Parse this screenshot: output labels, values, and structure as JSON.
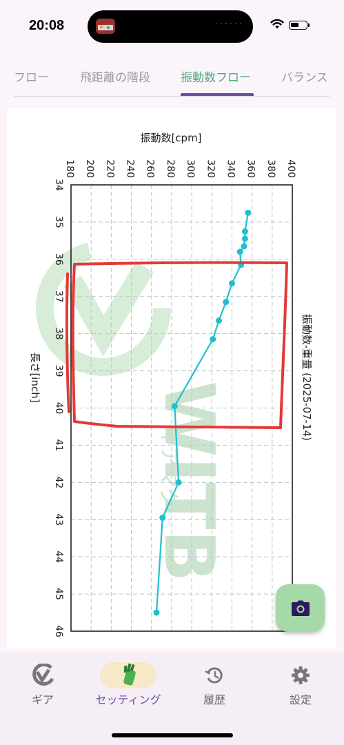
{
  "status_bar": {
    "time": "20:08",
    "island_dots": "······"
  },
  "tabs": [
    {
      "label": "フロー",
      "active": false
    },
    {
      "label": "飛距離の階段",
      "active": false
    },
    {
      "label": "振動数フロー",
      "active": true
    },
    {
      "label": "バランス",
      "active": false
    }
  ],
  "watermark": {
    "text": "WITB",
    "sub": "キアマグ"
  },
  "chart_data": {
    "type": "line",
    "orientation": "rotated-90-clockwise",
    "title": "振動数-重量 (2025-07-14)",
    "xlabel": "長さ[inch]",
    "ylabel": "振動数[cpm]",
    "xlim": [
      34,
      46
    ],
    "ylim": [
      180,
      400
    ],
    "x_ticks": [
      "34",
      "35",
      "36",
      "37",
      "38",
      "39",
      "40",
      "41",
      "42",
      "43",
      "44",
      "45",
      "46"
    ],
    "y_ticks": [
      "180",
      "200",
      "220",
      "240",
      "260",
      "280",
      "300",
      "320",
      "340",
      "360",
      "380",
      "400"
    ],
    "grid": true,
    "series": [
      {
        "x": [
          34.75,
          35.25,
          35.45,
          35.65,
          35.8,
          36.15,
          36.65,
          37.15,
          37.65,
          38.15,
          39.95,
          42.0,
          42.95,
          45.5
        ],
        "y": [
          356,
          353,
          353,
          352,
          348,
          349,
          340,
          334,
          327,
          321,
          283,
          287,
          271,
          265
        ],
        "color": "#1fbfcf"
      }
    ],
    "annotation": {
      "type": "hand-drawn-rectangle",
      "color": "#e53935"
    }
  },
  "fab": {
    "icon": "camera-icon"
  },
  "bottom_nav": [
    {
      "label": "ギア",
      "icon": "gear-logo-icon",
      "active": false
    },
    {
      "label": "セッティング",
      "icon": "golf-bag-icon",
      "active": true
    },
    {
      "label": "履歴",
      "icon": "history-icon",
      "active": false
    },
    {
      "label": "設定",
      "icon": "settings-icon",
      "active": false
    }
  ]
}
